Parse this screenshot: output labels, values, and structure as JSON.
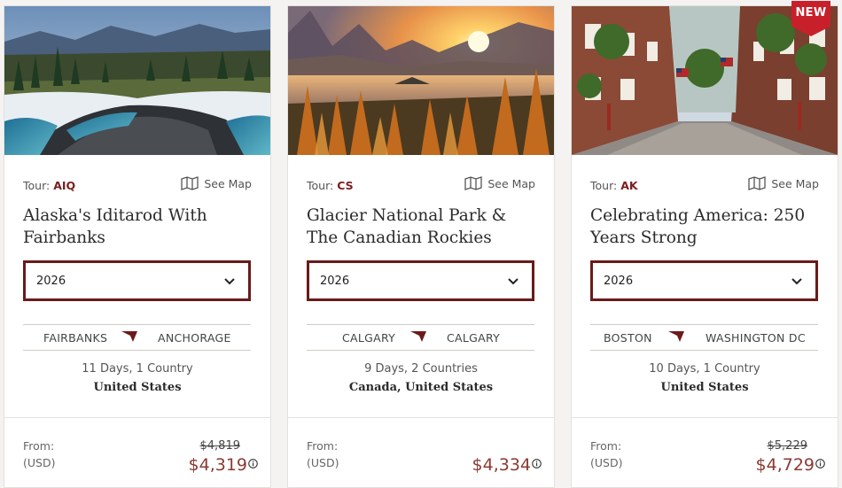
{
  "tours": [
    {
      "tour_label": "Tour:",
      "code": "AIQ",
      "see_map": "See Map",
      "title": "Alaska's Iditarod With Fairbanks",
      "year": "2026",
      "route_from": "FAIRBANKS",
      "route_to": "ANCHORAGE",
      "duration": "11 Days, 1 Country",
      "countries": "United States",
      "from_label": "From:",
      "currency_label": "(USD)",
      "old_price": "$4,819",
      "price": "$4,319",
      "image": "snowy river with pine forest and mountains"
    },
    {
      "tour_label": "Tour:",
      "code": "CS",
      "see_map": "See Map",
      "title": "Glacier National Park & The Canadian Rockies",
      "year": "2026",
      "route_from": "CALGARY",
      "route_to": "CALGARY",
      "duration": "9 Days, 2 Countries",
      "countries": "Canada, United States",
      "from_label": "From:",
      "currency_label": "(USD)",
      "old_price": "",
      "price": "$4,334",
      "image": "sunset over mountain lake with autumn trees"
    },
    {
      "tour_label": "Tour:",
      "code": "AK",
      "see_map": "See Map",
      "title": "Celebrating America: 250 Years Strong",
      "year": "2026",
      "route_from": "BOSTON",
      "route_to": "WASHINGTON DC",
      "duration": "10 Days, 1 Country",
      "countries": "United States",
      "from_label": "From:",
      "currency_label": "(USD)",
      "old_price": "$5,229",
      "price": "$4,729",
      "badge": "NEW",
      "image": "historic brick street with flags"
    }
  ],
  "icons": {
    "map": "map-icon",
    "chevron": "chevron-down-icon",
    "plane": "plane-icon",
    "info": "info-icon"
  },
  "colors": {
    "accent": "#6b1a1a",
    "price": "#8a3a32",
    "code": "#7a1f1f",
    "badge": "#c8202b"
  }
}
